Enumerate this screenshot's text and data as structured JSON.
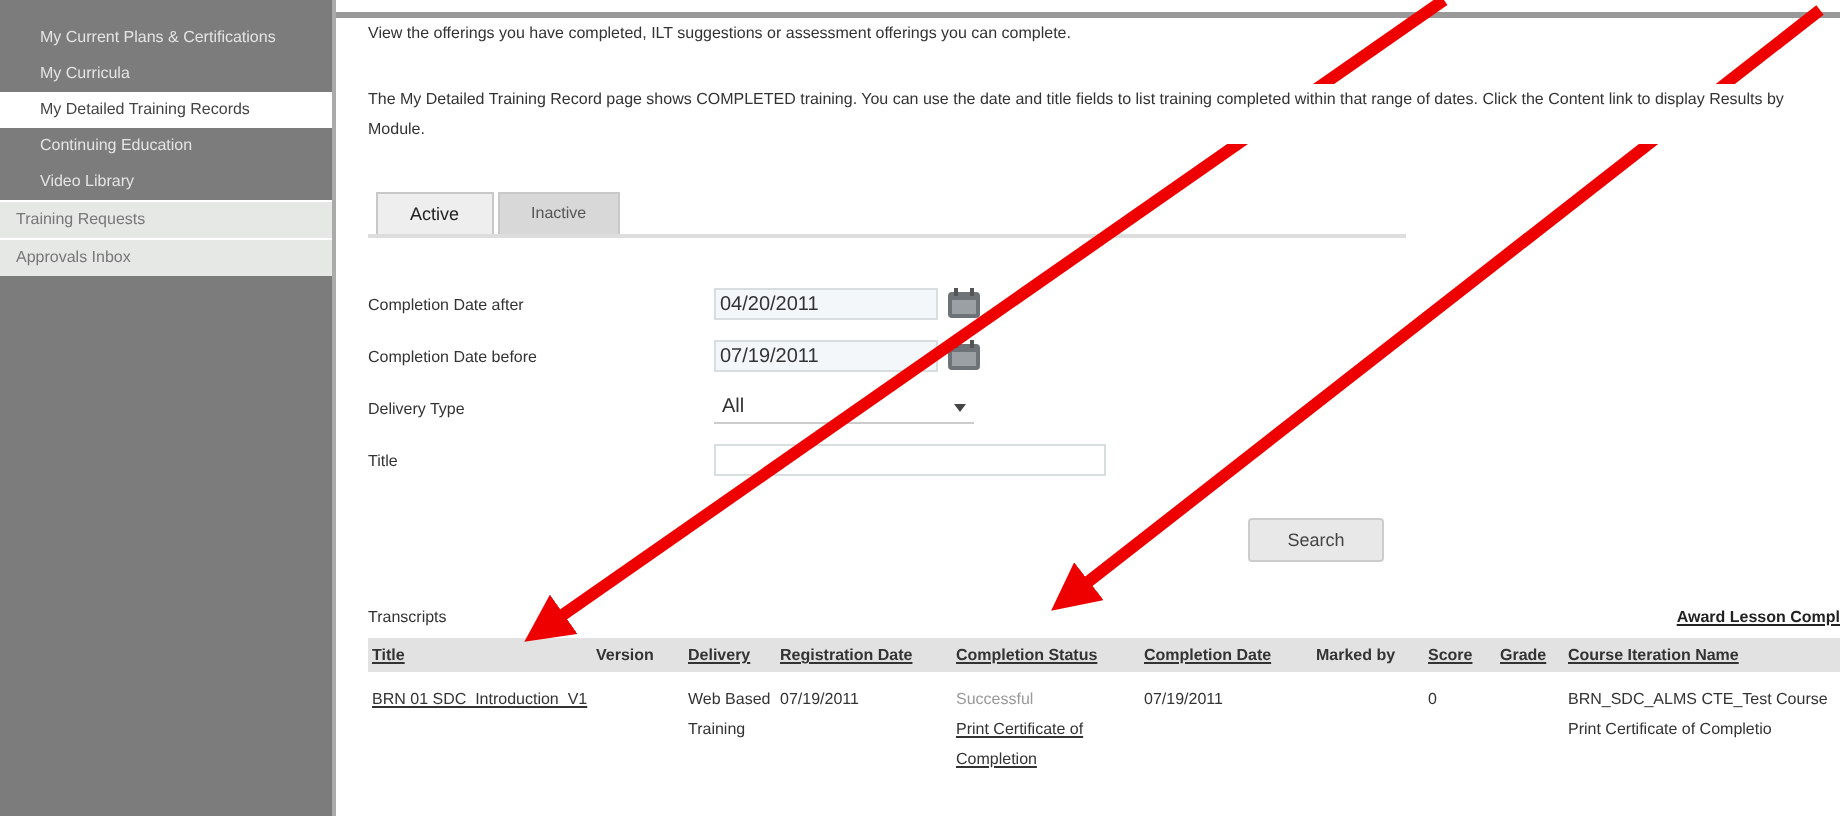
{
  "sidebar": {
    "items": [
      {
        "label": "My Current Plans & Certifications",
        "kind": "sub",
        "selected": false
      },
      {
        "label": "My Curricula",
        "kind": "sub",
        "selected": false
      },
      {
        "label": "My Detailed Training Records",
        "kind": "sub",
        "selected": true
      },
      {
        "label": "Continuing Education",
        "kind": "sub",
        "selected": false
      },
      {
        "label": "Video Library",
        "kind": "sub",
        "selected": false
      },
      {
        "label": "Training Requests",
        "kind": "top",
        "selected": false
      },
      {
        "label": "Approvals Inbox",
        "kind": "top",
        "selected": false
      }
    ]
  },
  "intro": "View the offerings you have completed, ILT suggestions or assessment offerings you can complete.",
  "description": "The My Detailed Training Record page shows COMPLETED training. You can use the date and title fields to list training completed within that range of dates. Click the Content link to display Results by Module.",
  "tabs": [
    {
      "label": "Active",
      "selected": true
    },
    {
      "label": "Inactive",
      "selected": false
    }
  ],
  "form": [
    {
      "label": "Completion Date after",
      "kind": "date",
      "value": "04/20/2011"
    },
    {
      "label": "Completion Date before",
      "kind": "date",
      "value": "07/19/2011"
    },
    {
      "label": "Delivery Type",
      "kind": "select",
      "value": "All"
    },
    {
      "label": "Title",
      "kind": "text"
    }
  ],
  "search_button": "Search",
  "transcripts": {
    "title": "Transcripts",
    "link": "Award Lesson Compl",
    "columns": [
      "Title",
      "Version",
      "Delivery",
      "Registration Date",
      "Completion Status",
      "Completion Date",
      "Marked by",
      "Score",
      "Grade",
      "Course Iteration Name"
    ],
    "rows": [
      {
        "title": "BRN 01 SDC_Introduction_V1",
        "delivery": "Web Based Training",
        "registration_date": "07/19/2011",
        "status": "Successful",
        "status_link": "Print Certificate of Completion",
        "completion_date": "07/19/2011",
        "score": "0",
        "iteration": "BRN_SDC_ALMS CTE_Test Course",
        "iteration_link": "Print Certificate of Completio"
      }
    ]
  }
}
